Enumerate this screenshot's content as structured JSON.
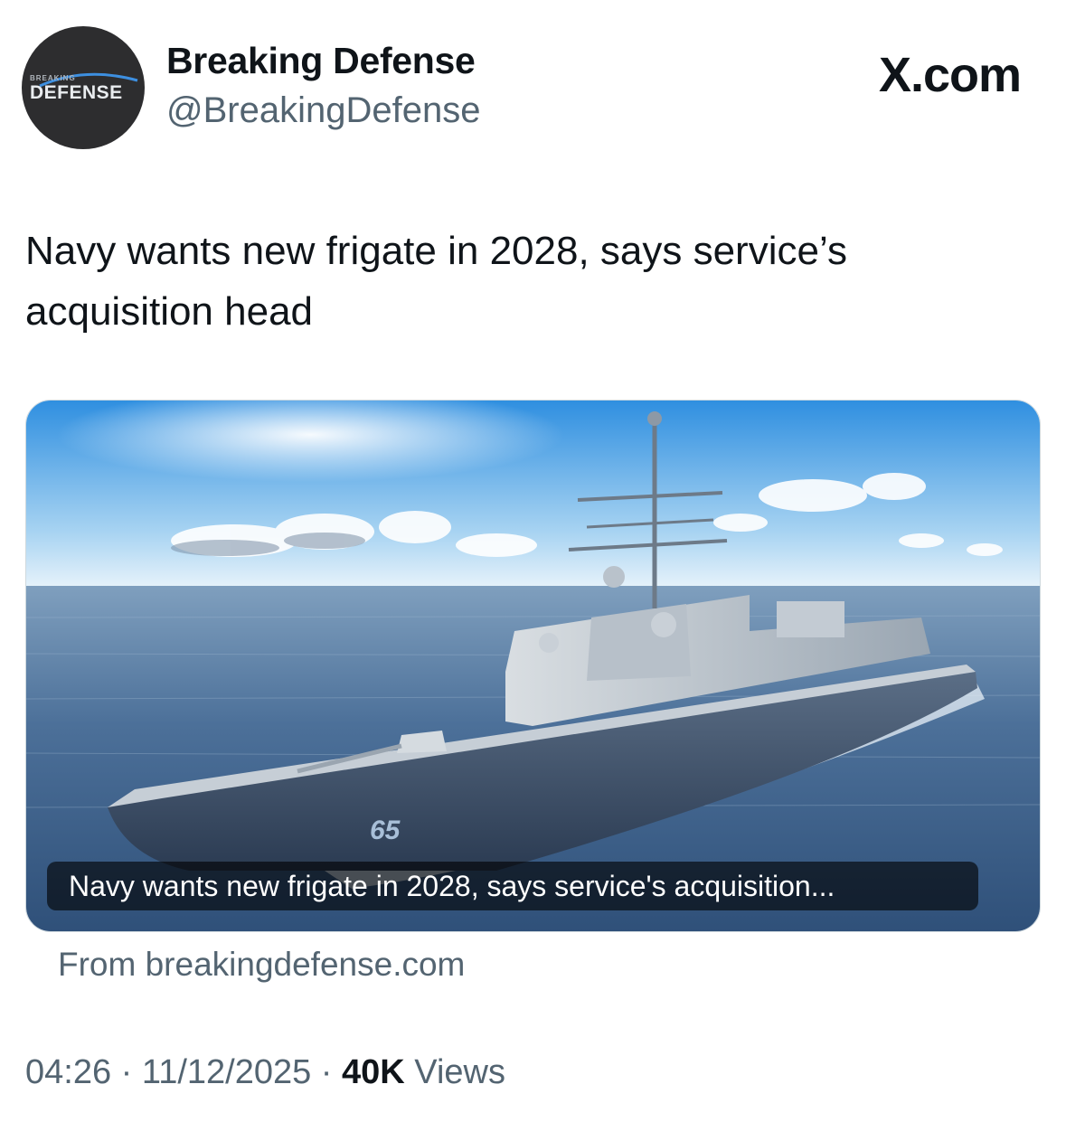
{
  "account": {
    "display_name": "Breaking Defense",
    "handle": "@BreakingDefense",
    "avatar_text_top": "BREAKING",
    "avatar_text_main": "DEFENSE",
    "avatar_icon": "breaking-defense-logo"
  },
  "site_label": "X.com",
  "tweet": {
    "text": "Navy wants new frigate in 2028, says service’s acquisition head"
  },
  "card": {
    "image_icon": "frigate-at-sea-image",
    "hull_number": "65",
    "caption": "Navy wants new frigate in 2028, says service's acquisition...",
    "source": "From breakingdefense.com"
  },
  "meta": {
    "time": "04:26",
    "date": "11/12/2025",
    "sep1": " · ",
    "sep2": " · ",
    "views_count": "40K",
    "views_label": " Views"
  },
  "colors": {
    "text_primary": "#0f1419",
    "text_secondary": "#536471",
    "avatar_bg": "#2d2d2f",
    "sky_top": "#2f8fe0",
    "sea": "#3c5f86"
  }
}
